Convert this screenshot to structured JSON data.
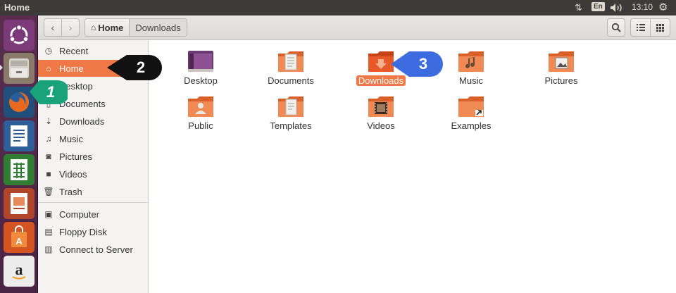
{
  "window": {
    "title": "Home"
  },
  "top_panel": {
    "network_icon": "updown-arrows-icon",
    "keyboard_layout": "En",
    "volume_icon": "speaker-icon",
    "clock": "13:10",
    "settings_icon": "gear-icon"
  },
  "launcher": {
    "items": [
      {
        "name": "ubuntu-dash",
        "icon": "ubuntu-logo-icon"
      },
      {
        "name": "files",
        "icon": "file-cabinet-icon",
        "active": true
      },
      {
        "name": "firefox",
        "icon": "firefox-icon"
      },
      {
        "name": "writer",
        "icon": "libreoffice-writer-icon"
      },
      {
        "name": "calc",
        "icon": "libreoffice-calc-icon"
      },
      {
        "name": "impress",
        "icon": "libreoffice-impress-icon"
      },
      {
        "name": "software-center",
        "icon": "shopping-bag-icon"
      },
      {
        "name": "amazon",
        "icon": "amazon-icon"
      }
    ]
  },
  "header": {
    "back_icon": "chevron-left-icon",
    "forward_icon": "chevron-right-icon",
    "breadcrumbs": [
      "Home",
      "Downloads"
    ],
    "search_icon": "search-icon",
    "list_view_icon": "list-icon",
    "grid_view_icon": "grid-icon"
  },
  "sidebar": {
    "items": [
      {
        "label": "Recent",
        "icon": "clock-icon"
      },
      {
        "label": "Home",
        "icon": "home-icon",
        "active": true
      },
      {
        "label": "Desktop",
        "icon": "desktop-icon"
      },
      {
        "label": "Documents",
        "icon": "document-icon"
      },
      {
        "label": "Downloads",
        "icon": "download-arrow-icon"
      },
      {
        "label": "Music",
        "icon": "music-note-icon"
      },
      {
        "label": "Pictures",
        "icon": "camera-icon"
      },
      {
        "label": "Videos",
        "icon": "video-icon"
      },
      {
        "label": "Trash",
        "icon": "trash-icon"
      }
    ],
    "devices": [
      {
        "label": "Computer",
        "icon": "computer-icon"
      },
      {
        "label": "Floppy Disk",
        "icon": "floppy-icon"
      },
      {
        "label": "Connect to Server",
        "icon": "server-icon"
      }
    ]
  },
  "folders": [
    {
      "label": "Desktop",
      "icon": "desktop-folder-icon"
    },
    {
      "label": "Documents",
      "icon": "documents-folder-icon"
    },
    {
      "label": "Downloads",
      "icon": "downloads-folder-icon",
      "selected": true
    },
    {
      "label": "Music",
      "icon": "music-folder-icon"
    },
    {
      "label": "Pictures",
      "icon": "pictures-folder-icon"
    },
    {
      "label": "Public",
      "icon": "public-folder-icon"
    },
    {
      "label": "Templates",
      "icon": "templates-folder-icon"
    },
    {
      "label": "Videos",
      "icon": "videos-folder-icon"
    },
    {
      "label": "Examples",
      "icon": "examples-folder-icon"
    }
  ],
  "annotations": [
    "1",
    "2",
    "3"
  ],
  "colors": {
    "accent": "#f07746",
    "panel": "#3c3b37",
    "launcher": "#4a2444",
    "bubble_1": "#1aa37a",
    "bubble_2": "#111111",
    "bubble_3": "#3d6be0"
  }
}
